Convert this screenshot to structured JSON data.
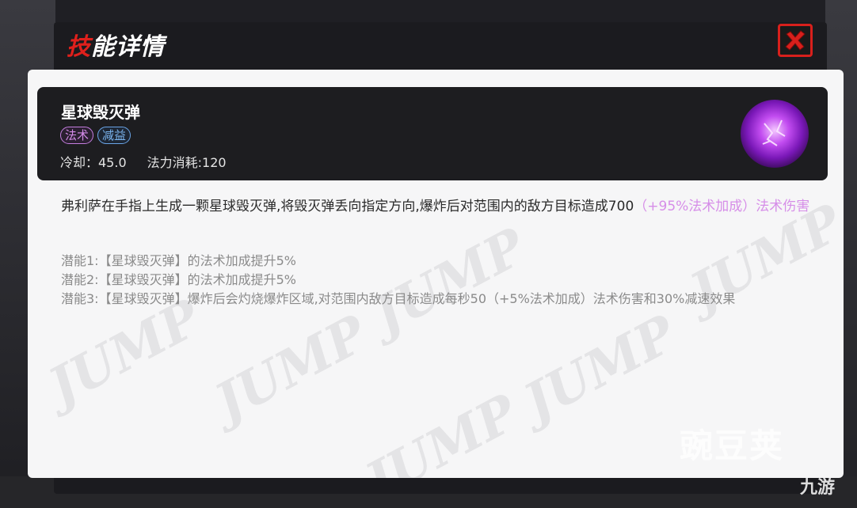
{
  "dialog": {
    "title_first": "技",
    "title_rest": "能详情"
  },
  "skill": {
    "name": "星球毁灭弹",
    "tags": [
      "法术",
      "减益"
    ],
    "cooldown": "冷却：45.0",
    "mana_cost": "法力消耗:120",
    "icon": "purple-orb-icon",
    "description_main": "弗利萨在手指上生成一颗星球毁灭弹,将毁灭弹丢向指定方向,爆炸后对范围内的敌方目标造成700",
    "description_bonus": "（+95%法术加成）法术伤害",
    "potentials": [
      "潜能1:【星球毁灭弹】的法术加成提升5%",
      "潜能2:【星球毁灭弹】的法术加成提升5%",
      "潜能3:【星球毁灭弹】爆炸后会灼烧爆炸区域,对范围内敌方目标造成每秒50（+5%法术加成）法术伤害和30%减速效果"
    ]
  },
  "watermarks": {
    "jump": "JUMP",
    "site_logo": "豌豆荚",
    "site_logo2": "九游"
  },
  "colors": {
    "accent_red": "#e0201c",
    "magic_tag": "#d48be8",
    "debuff_tag": "#7bb4ee",
    "bonus_text": "#d68ee8"
  }
}
